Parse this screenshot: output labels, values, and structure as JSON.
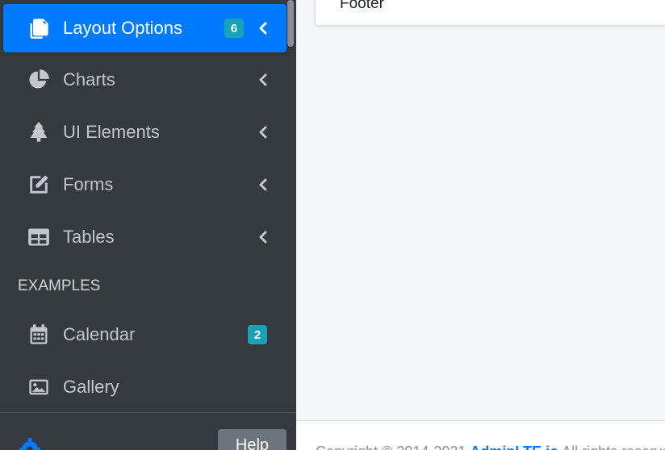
{
  "sidebar": {
    "items": [
      {
        "label": "Layout Options",
        "icon": "copy-icon",
        "badge": "6",
        "chevron": true,
        "active": true
      },
      {
        "label": "Charts",
        "icon": "chart-pie-icon",
        "chevron": true
      },
      {
        "label": "UI Elements",
        "icon": "tree-icon",
        "chevron": true
      },
      {
        "label": "Forms",
        "icon": "edit-icon",
        "chevron": true
      },
      {
        "label": "Tables",
        "icon": "table-icon",
        "chevron": true
      }
    ],
    "header": "EXAMPLES",
    "examples": [
      {
        "label": "Calendar",
        "icon": "calendar-icon",
        "badge": "2"
      },
      {
        "label": "Gallery",
        "icon": "image-icon"
      }
    ],
    "help_label": "Help"
  },
  "content": {
    "card_footer_text": "Footer",
    "footer": {
      "copyright": "Copyright © 2014-2021",
      "brand": "AdminLTE.io",
      "rights": "All rights reserved."
    }
  },
  "colors": {
    "sidebar_bg": "#343a40",
    "active_bg": "#007bff",
    "badge_bg": "#17a2b8",
    "help_bg": "#6c757d",
    "content_bg": "#f4f6f9"
  }
}
